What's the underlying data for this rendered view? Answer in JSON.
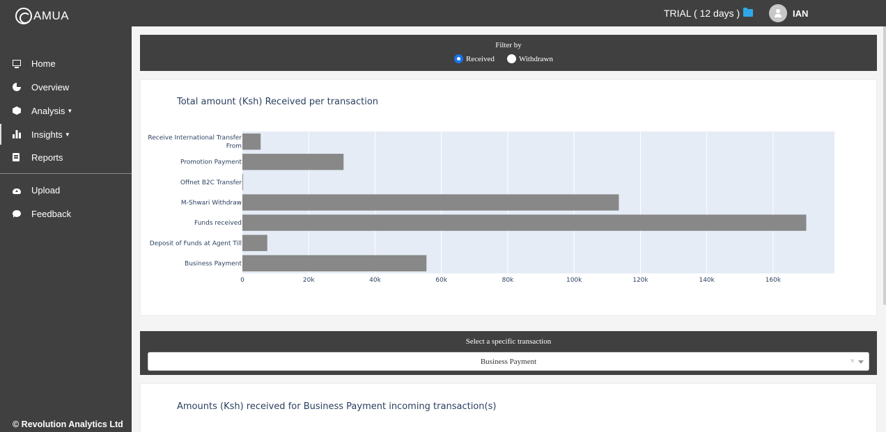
{
  "app": {
    "logo_text": "AMUA"
  },
  "header": {
    "trial": "TRIAL ( 12 days )",
    "username": "IAN"
  },
  "sidebar": {
    "items": [
      {
        "label": "Home",
        "icon": "monitor-icon"
      },
      {
        "label": "Overview",
        "icon": "pie-chart-icon"
      },
      {
        "label": "Analysis",
        "icon": "cube-icon",
        "dropdown": true
      },
      {
        "label": "Insights",
        "icon": "bar-chart-icon",
        "dropdown": true
      },
      {
        "label": "Reports",
        "icon": "file-icon"
      },
      {
        "label": "Upload",
        "icon": "cloud-upload-icon"
      },
      {
        "label": "Feedback",
        "icon": "chat-bubble-icon"
      }
    ],
    "footer": "© Revolution Analytics Ltd"
  },
  "filter": {
    "title": "Filter by",
    "options": [
      {
        "label": "Received",
        "checked": true
      },
      {
        "label": "Withdrawn",
        "checked": false
      }
    ]
  },
  "chart_card": {
    "title": "Total amount (Ksh) Received per transaction"
  },
  "chart_data": {
    "type": "bar",
    "orientation": "horizontal",
    "categories": [
      "Receive International Transfer From",
      "Promotion Payment",
      "Offnet B2C Transfer",
      "M-Shwari Withdraw",
      "Funds received",
      "Deposit of Funds at Agent Till",
      "Business Payment"
    ],
    "values": [
      5500,
      30500,
      200,
      113500,
      170000,
      7500,
      55500
    ],
    "xlim": [
      0,
      178500
    ],
    "xticks": [
      0,
      20000,
      40000,
      60000,
      80000,
      100000,
      120000,
      140000,
      160000
    ],
    "xtick_labels": [
      "0",
      "20k",
      "40k",
      "60k",
      "80k",
      "100k",
      "120k",
      "140k",
      "160k"
    ],
    "title": "",
    "xlabel": "",
    "ylabel": "",
    "grid": true,
    "bar_color": "#888888",
    "plot_bg": "#e5ecf6"
  },
  "transaction_select": {
    "label": "Select a specific transaction",
    "value": "Business Payment",
    "clear": "×"
  },
  "detail_card": {
    "title": "Amounts (Ksh) received for Business Payment incoming transaction(s)"
  },
  "colors": {
    "topbar": "#404040",
    "accent": "#1a73e8",
    "folder": "#2fa8e8"
  }
}
